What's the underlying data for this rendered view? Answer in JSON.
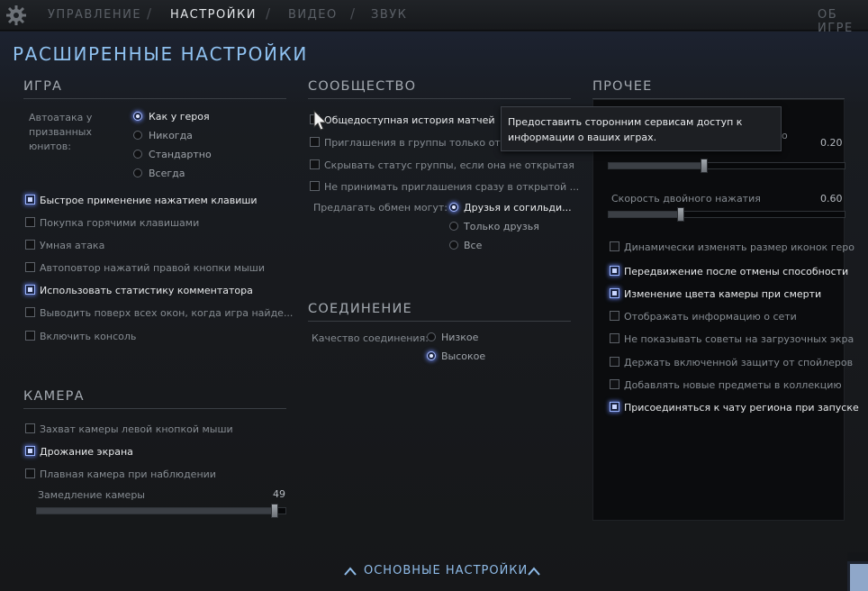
{
  "tabs": [
    "УПРАВЛЕНИЕ",
    "НАСТРОЙКИ",
    "ВИДЕО",
    "ЗВУК",
    "ОБ ИГРЕ"
  ],
  "page_title": "РАСШИРЕННЫЕ НАСТРОЙКИ",
  "game": {
    "title": "ИГРА",
    "autoattack_label_lines": [
      "Автоатака у",
      "призванных",
      "юнитов:"
    ],
    "autoattack_options": [
      "Как у героя",
      "Никогда",
      "Стандартно",
      "Всегда"
    ],
    "autoattack_selected": "Как у героя",
    "checkboxes": [
      {
        "label": "Быстрое применение нажатием клавиши",
        "checked": true
      },
      {
        "label": "Покупка горячими клавишами",
        "checked": false
      },
      {
        "label": "Умная атака",
        "checked": false
      },
      {
        "label": "Автоповтор нажатий правой кнопки мыши",
        "checked": false
      },
      {
        "label": "Использовать статистику комментатора",
        "checked": true
      },
      {
        "label": "Выводить поверх всех окон, когда игра найде...",
        "checked": false
      },
      {
        "label": "Включить консоль",
        "checked": false
      }
    ]
  },
  "camera": {
    "title": "КАМЕРА",
    "checkboxes": [
      {
        "label": "Захват камеры левой кнопкой мыши",
        "checked": false
      },
      {
        "label": "Дрожание экрана",
        "checked": true
      },
      {
        "label": "Плавная камера при наблюдении",
        "checked": false
      }
    ],
    "slowdown_label": "Замедление камеры",
    "slowdown_value": "49",
    "slowdown_fraction": 0.97
  },
  "community": {
    "title": "СООБЩЕСТВО",
    "checkboxes": [
      {
        "label": "Общедоступная история матчей",
        "checked": false
      },
      {
        "label": "Приглашения в группы только от д",
        "checked": false
      },
      {
        "label": "Скрывать статус группы, если она не открытая",
        "checked": false
      },
      {
        "label": "Не принимать приглашения сразу в открытой ...",
        "checked": false
      }
    ],
    "trade_label": "Предлагать обмен могут:",
    "trade_options": [
      "Друзья и согильди...",
      "Только друзья",
      "Все"
    ],
    "trade_selected": "Друзья и согильди..."
  },
  "connection": {
    "title": "СОЕДИНЕНИЕ",
    "quality_label": "Качество соединения:",
    "options": [
      "Низкое",
      "Высокое"
    ],
    "selected": "Высокое"
  },
  "other": {
    "title": "ПРОЧЕЕ",
    "slider1_label_tail": "о",
    "slider1_value": "0.20",
    "slider1_fraction": 0.4,
    "slider2_label": "Скорость двойного нажатия",
    "slider2_value": "0.60",
    "slider2_fraction": 0.3,
    "checkboxes": [
      {
        "label": "Динамически изменять размер иконок геро",
        "checked": false
      },
      {
        "label": "Передвижение после отмены способности",
        "checked": true
      },
      {
        "label": "Изменение цвета камеры при смерти",
        "checked": true
      },
      {
        "label": "Отображать информацию о сети",
        "checked": false
      },
      {
        "label": "Не показывать советы на загрузочных экра",
        "checked": false
      },
      {
        "label": "Держать включенной защиту от спойлеров",
        "checked": false
      },
      {
        "label": "Добавлять новые предметы в коллекцию",
        "checked": false
      },
      {
        "label": "Присоединяться к чату региона при запуске",
        "checked": true
      }
    ]
  },
  "tooltip": "Предоставить сторонним сервисам доступ к информации о ваших играх.",
  "bottom_link": "ОСНОВНЫЕ НАСТРОЙКИ",
  "colors": {
    "accent": "#8fc1f0",
    "checked_glow": "#6e8cff",
    "background": "#161719"
  }
}
